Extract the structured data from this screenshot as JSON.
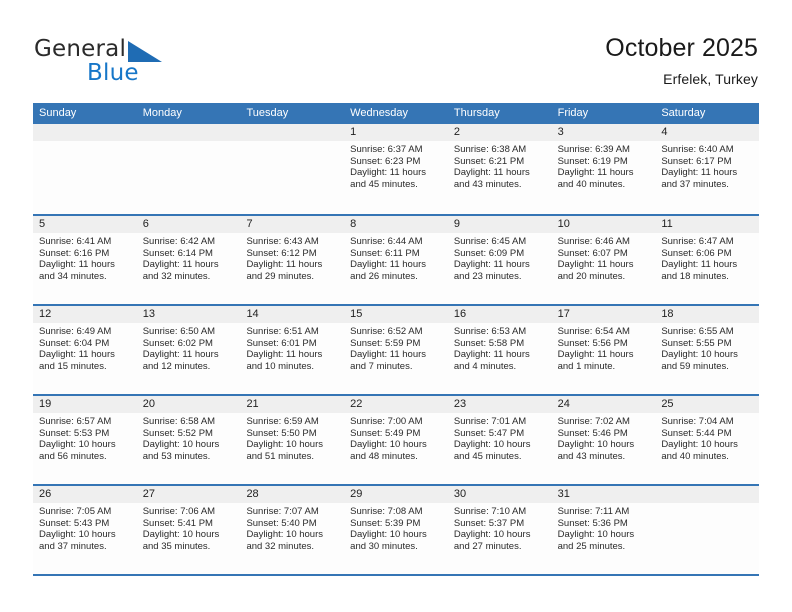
{
  "brand": {
    "name_line1": "General",
    "name_line2": "Blue",
    "triangle_color": "#1f6cb4",
    "blue_color": "#1676c8"
  },
  "header": {
    "title": "October 2025",
    "subtitle": "Erfelek, Turkey"
  },
  "theme": {
    "header_blue": "#3575b5",
    "daynum_band": "#efefef",
    "cell_bg": "#fdfdfd",
    "text": "#2a2a2a"
  },
  "calendar": {
    "weekday_headers": [
      "Sunday",
      "Monday",
      "Tuesday",
      "Wednesday",
      "Thursday",
      "Friday",
      "Saturday"
    ],
    "weeks": [
      [
        {
          "day": "",
          "empty": true,
          "sunrise": "",
          "sunset": "",
          "daylight_l1": "",
          "daylight_l2": ""
        },
        {
          "day": "",
          "empty": true,
          "sunrise": "",
          "sunset": "",
          "daylight_l1": "",
          "daylight_l2": ""
        },
        {
          "day": "",
          "empty": true,
          "sunrise": "",
          "sunset": "",
          "daylight_l1": "",
          "daylight_l2": ""
        },
        {
          "day": "1",
          "empty": false,
          "sunrise": "Sunrise: 6:37 AM",
          "sunset": "Sunset: 6:23 PM",
          "daylight_l1": "Daylight: 11 hours",
          "daylight_l2": "and 45 minutes."
        },
        {
          "day": "2",
          "empty": false,
          "sunrise": "Sunrise: 6:38 AM",
          "sunset": "Sunset: 6:21 PM",
          "daylight_l1": "Daylight: 11 hours",
          "daylight_l2": "and 43 minutes."
        },
        {
          "day": "3",
          "empty": false,
          "sunrise": "Sunrise: 6:39 AM",
          "sunset": "Sunset: 6:19 PM",
          "daylight_l1": "Daylight: 11 hours",
          "daylight_l2": "and 40 minutes."
        },
        {
          "day": "4",
          "empty": false,
          "sunrise": "Sunrise: 6:40 AM",
          "sunset": "Sunset: 6:17 PM",
          "daylight_l1": "Daylight: 11 hours",
          "daylight_l2": "and 37 minutes."
        }
      ],
      [
        {
          "day": "5",
          "empty": false,
          "sunrise": "Sunrise: 6:41 AM",
          "sunset": "Sunset: 6:16 PM",
          "daylight_l1": "Daylight: 11 hours",
          "daylight_l2": "and 34 minutes."
        },
        {
          "day": "6",
          "empty": false,
          "sunrise": "Sunrise: 6:42 AM",
          "sunset": "Sunset: 6:14 PM",
          "daylight_l1": "Daylight: 11 hours",
          "daylight_l2": "and 32 minutes."
        },
        {
          "day": "7",
          "empty": false,
          "sunrise": "Sunrise: 6:43 AM",
          "sunset": "Sunset: 6:12 PM",
          "daylight_l1": "Daylight: 11 hours",
          "daylight_l2": "and 29 minutes."
        },
        {
          "day": "8",
          "empty": false,
          "sunrise": "Sunrise: 6:44 AM",
          "sunset": "Sunset: 6:11 PM",
          "daylight_l1": "Daylight: 11 hours",
          "daylight_l2": "and 26 minutes."
        },
        {
          "day": "9",
          "empty": false,
          "sunrise": "Sunrise: 6:45 AM",
          "sunset": "Sunset: 6:09 PM",
          "daylight_l1": "Daylight: 11 hours",
          "daylight_l2": "and 23 minutes."
        },
        {
          "day": "10",
          "empty": false,
          "sunrise": "Sunrise: 6:46 AM",
          "sunset": "Sunset: 6:07 PM",
          "daylight_l1": "Daylight: 11 hours",
          "daylight_l2": "and 20 minutes."
        },
        {
          "day": "11",
          "empty": false,
          "sunrise": "Sunrise: 6:47 AM",
          "sunset": "Sunset: 6:06 PM",
          "daylight_l1": "Daylight: 11 hours",
          "daylight_l2": "and 18 minutes."
        }
      ],
      [
        {
          "day": "12",
          "empty": false,
          "sunrise": "Sunrise: 6:49 AM",
          "sunset": "Sunset: 6:04 PM",
          "daylight_l1": "Daylight: 11 hours",
          "daylight_l2": "and 15 minutes."
        },
        {
          "day": "13",
          "empty": false,
          "sunrise": "Sunrise: 6:50 AM",
          "sunset": "Sunset: 6:02 PM",
          "daylight_l1": "Daylight: 11 hours",
          "daylight_l2": "and 12 minutes."
        },
        {
          "day": "14",
          "empty": false,
          "sunrise": "Sunrise: 6:51 AM",
          "sunset": "Sunset: 6:01 PM",
          "daylight_l1": "Daylight: 11 hours",
          "daylight_l2": "and 10 minutes."
        },
        {
          "day": "15",
          "empty": false,
          "sunrise": "Sunrise: 6:52 AM",
          "sunset": "Sunset: 5:59 PM",
          "daylight_l1": "Daylight: 11 hours",
          "daylight_l2": "and 7 minutes."
        },
        {
          "day": "16",
          "empty": false,
          "sunrise": "Sunrise: 6:53 AM",
          "sunset": "Sunset: 5:58 PM",
          "daylight_l1": "Daylight: 11 hours",
          "daylight_l2": "and 4 minutes."
        },
        {
          "day": "17",
          "empty": false,
          "sunrise": "Sunrise: 6:54 AM",
          "sunset": "Sunset: 5:56 PM",
          "daylight_l1": "Daylight: 11 hours",
          "daylight_l2": "and 1 minute."
        },
        {
          "day": "18",
          "empty": false,
          "sunrise": "Sunrise: 6:55 AM",
          "sunset": "Sunset: 5:55 PM",
          "daylight_l1": "Daylight: 10 hours",
          "daylight_l2": "and 59 minutes."
        }
      ],
      [
        {
          "day": "19",
          "empty": false,
          "sunrise": "Sunrise: 6:57 AM",
          "sunset": "Sunset: 5:53 PM",
          "daylight_l1": "Daylight: 10 hours",
          "daylight_l2": "and 56 minutes."
        },
        {
          "day": "20",
          "empty": false,
          "sunrise": "Sunrise: 6:58 AM",
          "sunset": "Sunset: 5:52 PM",
          "daylight_l1": "Daylight: 10 hours",
          "daylight_l2": "and 53 minutes."
        },
        {
          "day": "21",
          "empty": false,
          "sunrise": "Sunrise: 6:59 AM",
          "sunset": "Sunset: 5:50 PM",
          "daylight_l1": "Daylight: 10 hours",
          "daylight_l2": "and 51 minutes."
        },
        {
          "day": "22",
          "empty": false,
          "sunrise": "Sunrise: 7:00 AM",
          "sunset": "Sunset: 5:49 PM",
          "daylight_l1": "Daylight: 10 hours",
          "daylight_l2": "and 48 minutes."
        },
        {
          "day": "23",
          "empty": false,
          "sunrise": "Sunrise: 7:01 AM",
          "sunset": "Sunset: 5:47 PM",
          "daylight_l1": "Daylight: 10 hours",
          "daylight_l2": "and 45 minutes."
        },
        {
          "day": "24",
          "empty": false,
          "sunrise": "Sunrise: 7:02 AM",
          "sunset": "Sunset: 5:46 PM",
          "daylight_l1": "Daylight: 10 hours",
          "daylight_l2": "and 43 minutes."
        },
        {
          "day": "25",
          "empty": false,
          "sunrise": "Sunrise: 7:04 AM",
          "sunset": "Sunset: 5:44 PM",
          "daylight_l1": "Daylight: 10 hours",
          "daylight_l2": "and 40 minutes."
        }
      ],
      [
        {
          "day": "26",
          "empty": false,
          "sunrise": "Sunrise: 7:05 AM",
          "sunset": "Sunset: 5:43 PM",
          "daylight_l1": "Daylight: 10 hours",
          "daylight_l2": "and 37 minutes."
        },
        {
          "day": "27",
          "empty": false,
          "sunrise": "Sunrise: 7:06 AM",
          "sunset": "Sunset: 5:41 PM",
          "daylight_l1": "Daylight: 10 hours",
          "daylight_l2": "and 35 minutes."
        },
        {
          "day": "28",
          "empty": false,
          "sunrise": "Sunrise: 7:07 AM",
          "sunset": "Sunset: 5:40 PM",
          "daylight_l1": "Daylight: 10 hours",
          "daylight_l2": "and 32 minutes."
        },
        {
          "day": "29",
          "empty": false,
          "sunrise": "Sunrise: 7:08 AM",
          "sunset": "Sunset: 5:39 PM",
          "daylight_l1": "Daylight: 10 hours",
          "daylight_l2": "and 30 minutes."
        },
        {
          "day": "30",
          "empty": false,
          "sunrise": "Sunrise: 7:10 AM",
          "sunset": "Sunset: 5:37 PM",
          "daylight_l1": "Daylight: 10 hours",
          "daylight_l2": "and 27 minutes."
        },
        {
          "day": "31",
          "empty": false,
          "sunrise": "Sunrise: 7:11 AM",
          "sunset": "Sunset: 5:36 PM",
          "daylight_l1": "Daylight: 10 hours",
          "daylight_l2": "and 25 minutes."
        },
        {
          "day": "",
          "empty": true,
          "sunrise": "",
          "sunset": "",
          "daylight_l1": "",
          "daylight_l2": ""
        }
      ]
    ]
  }
}
